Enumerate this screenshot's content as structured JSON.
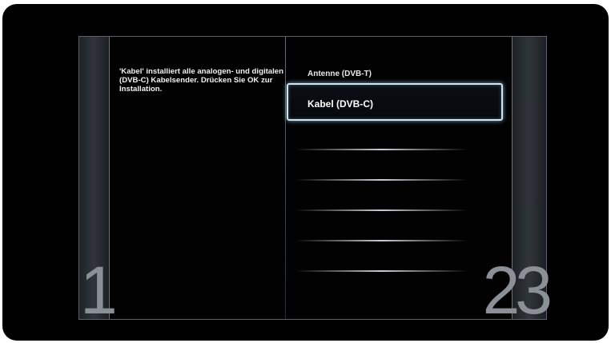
{
  "info_text": "'Kabel' installiert alle analogen- und digitalen (DVB-C) Kabelsender. Drücken Sie OK zur Installation.",
  "options": [
    {
      "label": "Antenne (DVB-T)",
      "selected": false
    },
    {
      "label": "Kabel (DVB-C)",
      "selected": true
    }
  ],
  "step_left": "1",
  "step_right": "23",
  "colors": {
    "background": "#000000",
    "highlight_border": "#cfe6f2",
    "text": "#f2f2f2"
  }
}
